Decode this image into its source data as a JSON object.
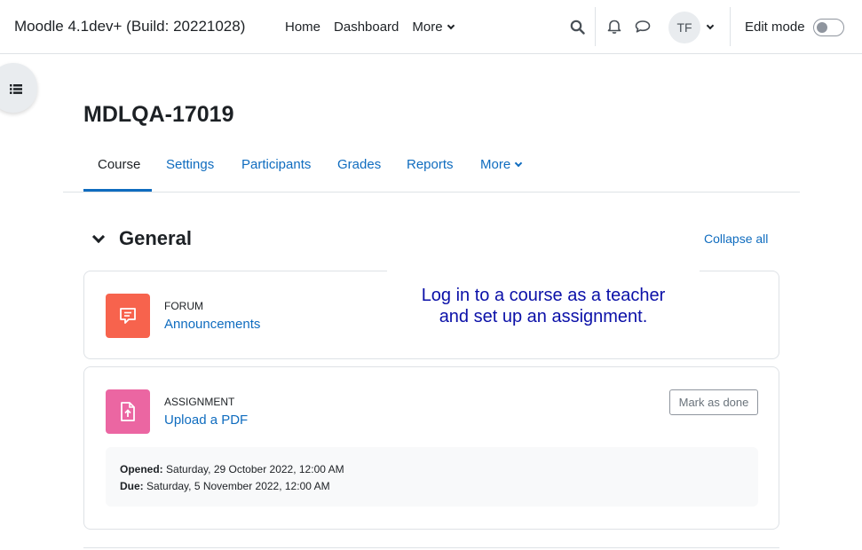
{
  "header": {
    "site_name": "Moodle 4.1dev+ (Build: 20221028)",
    "nav": [
      "Home",
      "Dashboard",
      "More"
    ],
    "avatar_initials": "TF",
    "edit_mode_label": "Edit mode",
    "edit_mode_on": false
  },
  "page": {
    "title": "MDLQA-17019",
    "tabs": [
      "Course",
      "Settings",
      "Participants",
      "Grades",
      "Reports",
      "More"
    ],
    "active_tab": "Course"
  },
  "section": {
    "title": "General",
    "collapse_all": "Collapse all"
  },
  "activities": [
    {
      "type": "FORUM",
      "name": "Announcements",
      "icon": "forum-icon",
      "color": "#f7634d"
    },
    {
      "type": "ASSIGNMENT",
      "name": "Upload a PDF",
      "icon": "assignment-upload-icon",
      "color": "#eb66a2",
      "completion_button": "Mark as done",
      "opened_label": "Opened:",
      "opened_value": "Saturday, 29 October 2022, 12:00 AM",
      "due_label": "Due:",
      "due_value": "Saturday, 5 November 2022, 12:00 AM"
    }
  ],
  "overlay": {
    "line1": "Log in to a course as a teacher",
    "line2": "and set up an assignment."
  },
  "colors": {
    "link": "#0f6cbf",
    "text": "#1d2125",
    "caption": "#0b10a8"
  }
}
